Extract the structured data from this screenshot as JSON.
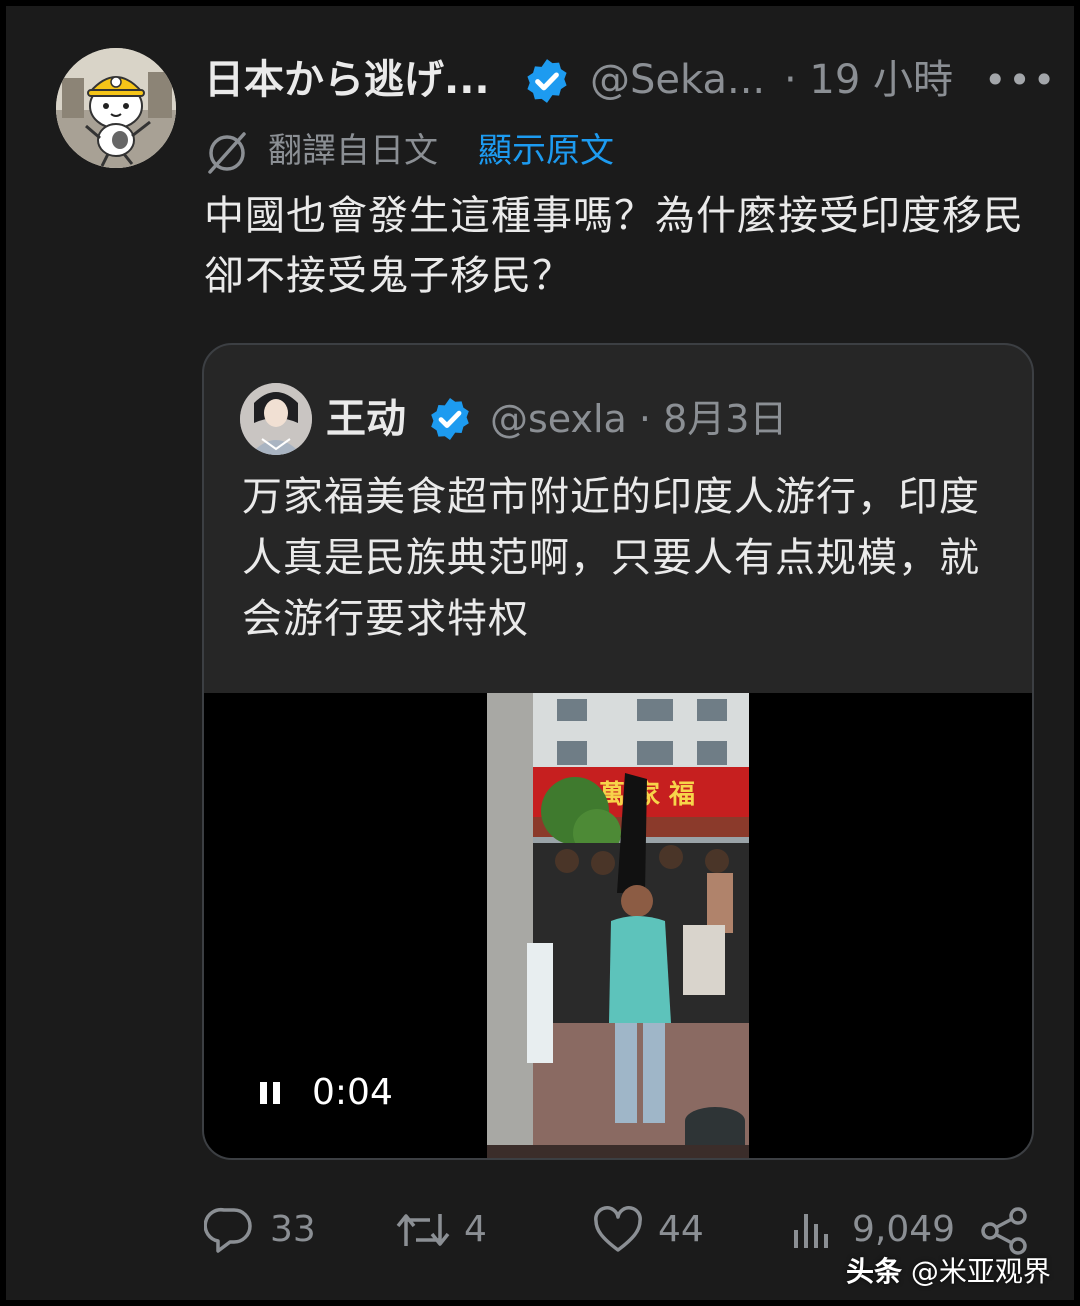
{
  "post": {
    "author_name": "日本から逃げ...",
    "author_handle": "@Seka...",
    "time": "· 19 小時",
    "more_label": "•••",
    "translated_label": "翻譯自日文",
    "show_original_label": "顯示原文",
    "text": "中國也會發生這種事嗎？為什麼接受印度移民卻不接受鬼子移民？"
  },
  "quoted": {
    "author_name": "王动",
    "handle_time": "@sexla · 8月3日",
    "text": "万家福美食超市附近的印度人游行，印度人真是民族典范啊，只要人有点规模，就会游行要求特权",
    "video": {
      "time": "0:04",
      "sign_text": "萬 家 福"
    }
  },
  "actions": {
    "replies": "33",
    "reposts": "4",
    "likes": "44",
    "views": "9,049"
  },
  "watermark": {
    "app": "头条",
    "account": "@米亚观界"
  },
  "colors": {
    "background": "#1b1b1b",
    "accent": "#1d9bf0",
    "muted_text": "#8b8f94",
    "primary_text": "#eaeaea"
  }
}
